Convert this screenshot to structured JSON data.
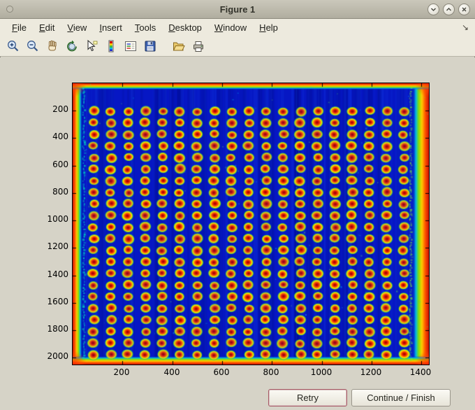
{
  "window": {
    "title": "Figure 1"
  },
  "menu": {
    "items": [
      "File",
      "Edit",
      "View",
      "Insert",
      "Tools",
      "Desktop",
      "Window",
      "Help"
    ],
    "end_glyph": "↘"
  },
  "toolbar": {
    "buttons": [
      "zoom-in",
      "zoom-out",
      "pan",
      "rotate-3d",
      "data-cursor",
      "insert-colorbar",
      "insert-legend",
      "save",
      "open",
      "print"
    ]
  },
  "figure": {
    "x_ticks": [
      "200",
      "400",
      "600",
      "800",
      "1000",
      "1200",
      "1400"
    ],
    "y_ticks": [
      "200",
      "400",
      "600",
      "800",
      "1000",
      "1200",
      "1400",
      "1600",
      "1800",
      "2000"
    ],
    "x_range": [
      0,
      1430
    ],
    "y_range": [
      0,
      2050
    ],
    "image": {
      "description": "microarray scan shown with jet colormap: grid of red/yellow spots on blue background, saturated red borders at image edges",
      "colormap": "jet",
      "background": "#0617c4",
      "grid": {
        "rows": 22,
        "cols": 19
      },
      "spot_gradient": [
        "#8b0000",
        "#e81500",
        "#ff8800",
        "#ffe800",
        "#55cc33",
        "rgba(0,120,255,0)"
      ],
      "edge_gradient": [
        "#cc1100",
        "#ff5500",
        "#ffcc00",
        "#88e000",
        "#00b8e8",
        "rgba(0,30,200,0)"
      ],
      "seed": 7
    }
  },
  "buttons": {
    "retry": "Retry",
    "continue_finish": "Continue / Finish"
  }
}
